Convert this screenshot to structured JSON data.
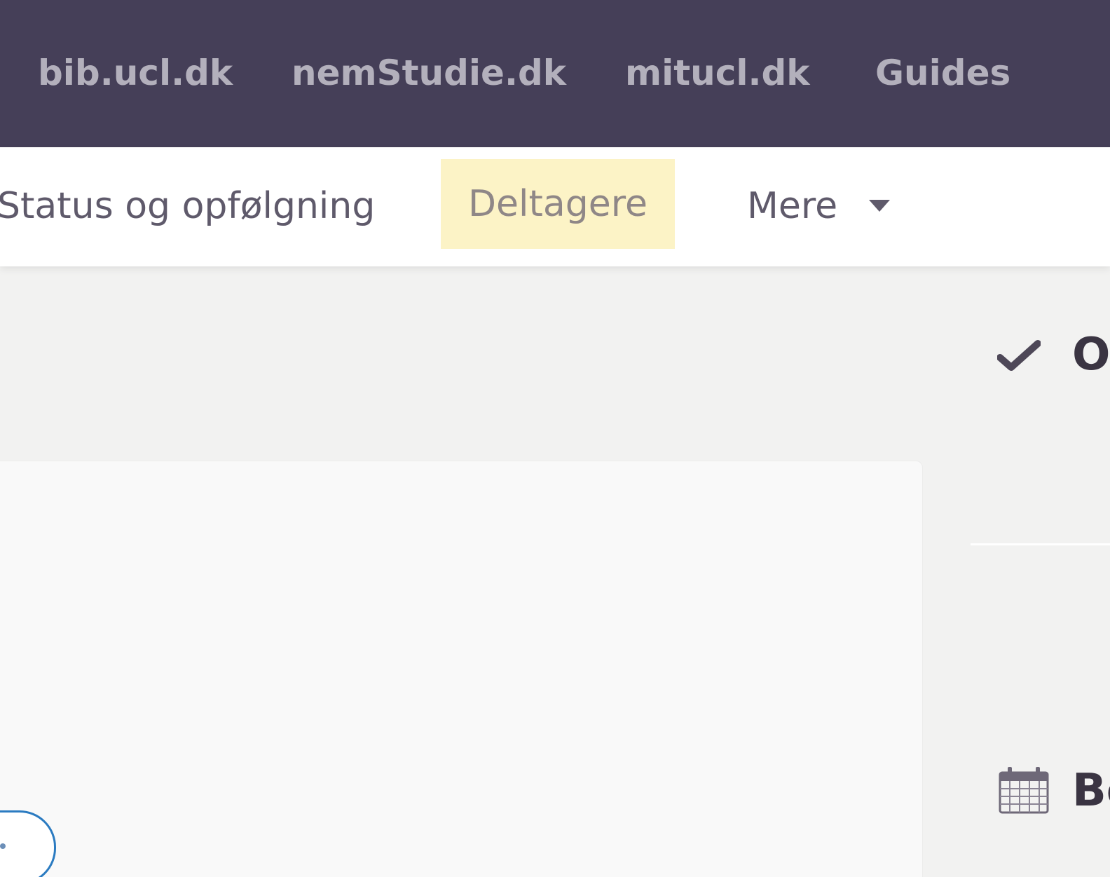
{
  "top_nav": {
    "links": [
      "bib.ucl.dk",
      "nemStudie.dk",
      "mitucl.dk",
      "Guides"
    ]
  },
  "sub_nav": {
    "status": "Status og opfølgning",
    "deltagere": "Deltagere",
    "mere": "Mere"
  },
  "right_panel": {
    "heading_1": "Op",
    "heading_2": "Be"
  },
  "icons": {
    "check": "check-icon",
    "calendar": "calendar-icon",
    "caret": "caret-down-icon"
  },
  "colors": {
    "topbar_bg": "#453f58",
    "topbar_link": "#b3b0bc",
    "active_tab_bg": "#fcf3c6",
    "pill_border": "#2b7bc1"
  }
}
